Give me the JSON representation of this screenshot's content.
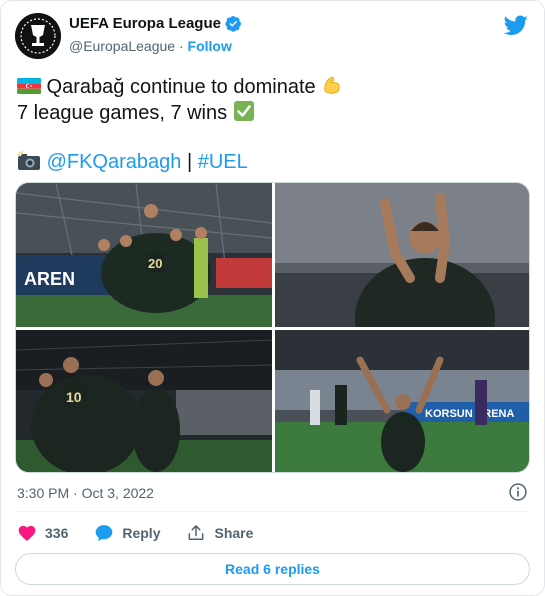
{
  "author": {
    "display_name": "UEFA Europa League",
    "handle": "@EuropaLeague",
    "separator": " · ",
    "follow_label": "Follow"
  },
  "tweet": {
    "line1_text": " Qarabağ continue to dominate ",
    "line2_text": "7 league games, 7 wins ",
    "line4_mention": "@FKQarabagh",
    "line4_separator": " | ",
    "line4_hashtag": "#UEL"
  },
  "meta": {
    "time": "3:30 PM",
    "separator": " · ",
    "date": "Oct 3, 2022"
  },
  "actions": {
    "like_count": "336",
    "reply_label": "Reply",
    "share_label": "Share"
  },
  "read_replies_label": "Read 6 replies",
  "colors": {
    "accent": "#1d9bf0",
    "like": "#f91880",
    "muted": "#536471"
  },
  "icons": [
    "twitter-bird-icon",
    "verified-badge-icon",
    "azerbaijan-flag-icon",
    "flexed-biceps-icon",
    "check-mark-icon",
    "camera-flash-icon",
    "info-icon",
    "heart-icon",
    "reply-bubble-icon",
    "share-icon"
  ]
}
